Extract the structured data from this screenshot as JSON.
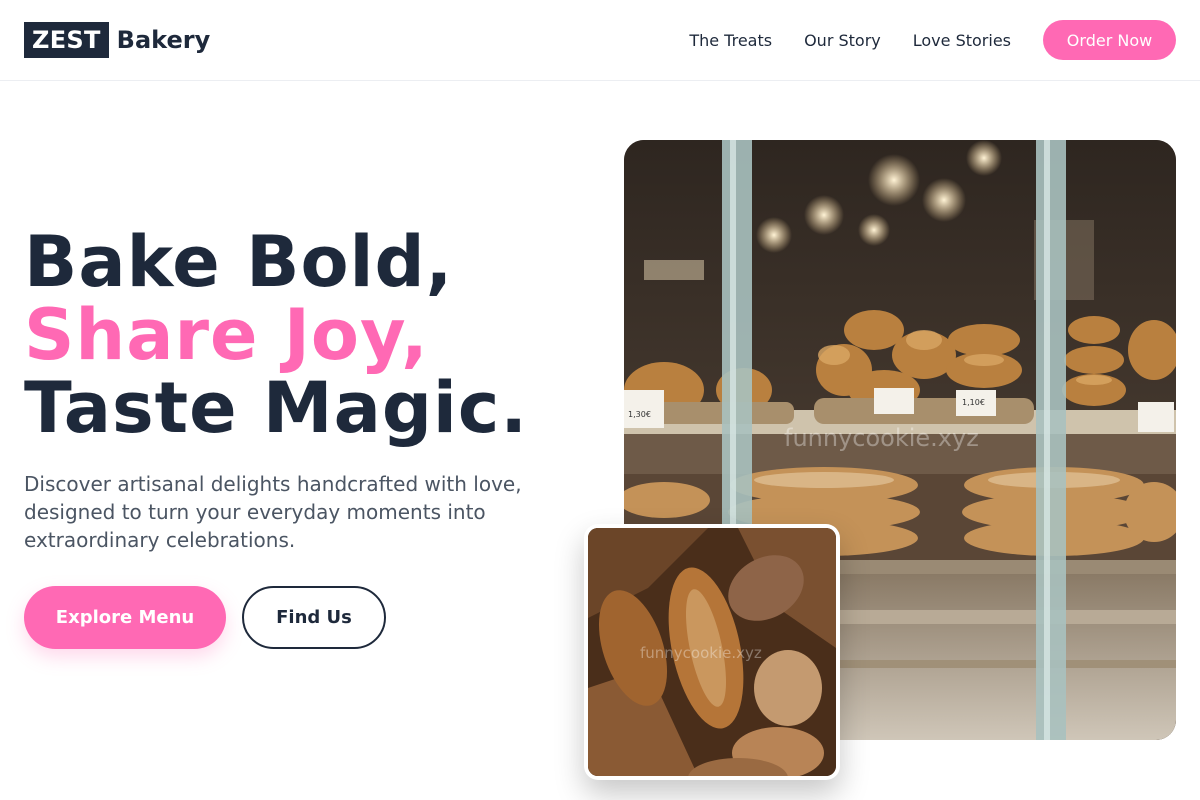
{
  "header": {
    "logo_box": "ZEST",
    "logo_word": "Bakery",
    "nav": [
      "The Treats",
      "Our Story",
      "Love Stories"
    ],
    "cta": "Order Now"
  },
  "hero": {
    "line1": "Bake Bold,",
    "line2": "Share Joy,",
    "line3": "Taste Magic.",
    "lead": "Discover artisanal delights handcrafted with love, designed to turn your everyday moments into extraordinary celebrations.",
    "primary_button": "Explore Menu",
    "secondary_button": "Find Us"
  },
  "images": {
    "main_watermark": "funnycookie.xyz",
    "secondary_watermark": "funnycookie.xyz",
    "price_tags": [
      "1,30€",
      "1,10€"
    ]
  },
  "colors": {
    "accent": "#ff69b4",
    "dark": "#1e293b",
    "body_text": "#4b5563"
  }
}
